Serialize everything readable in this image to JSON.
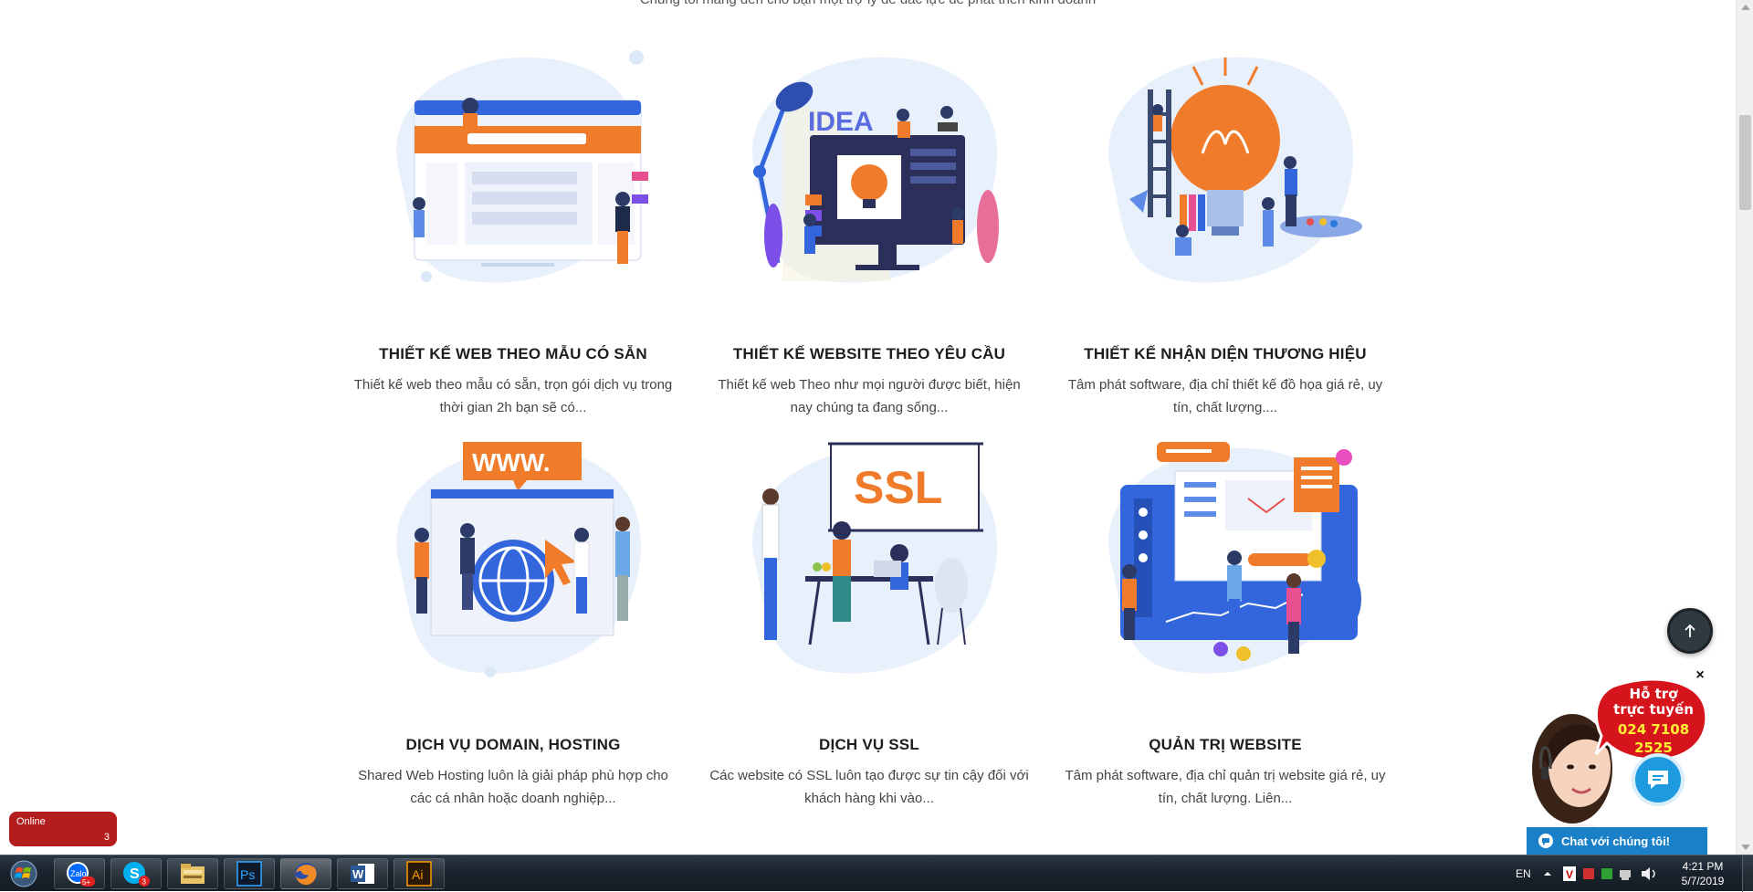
{
  "page": {
    "top_cut_text": "Chúng tôi mang đến cho bạn một trợ lý để đắc lực để phát triển kinh doanh"
  },
  "services": [
    {
      "title": "THIẾT KẾ WEB THEO MẪU CÓ SẴN",
      "desc": "Thiết kế web theo mẫu có sẵn, trọn gói dịch vụ trong thời gian 2h bạn sẽ có..."
    },
    {
      "title": "THIẾT KẾ WEBSITE THEO YÊU CẦU",
      "desc": "Thiết kế web Theo như mọi người được biết, hiện nay chúng ta đang sống..."
    },
    {
      "title": "THIẾT KẾ NHẬN DIỆN THƯƠNG HIỆU",
      "desc": "Tâm phát software, địa chỉ thiết kế đồ họa giá rẻ, uy tín, chất lượng...."
    },
    {
      "title": "DỊCH VỤ DOMAIN, HOSTING",
      "desc": "Shared Web Hosting luôn là giải pháp phù hợp cho các cá nhân hoặc doanh nghiệp..."
    },
    {
      "title": "DỊCH VỤ SSL",
      "desc": "Các website có SSL luôn tạo được sự tin cậy đối với khách hàng khi vào..."
    },
    {
      "title": "QUẢN TRỊ WEBSITE",
      "desc": "Tâm phát software, địa chỉ quản trị website giá rẻ, uy tín, chất lượng. Liên..."
    }
  ],
  "illustrations": {
    "idea_text": "IDEA",
    "www_text": "WWW.",
    "ssl_text": "SSL"
  },
  "online_badge": {
    "label": "Online",
    "count": "3"
  },
  "support": {
    "line1": "Hỗ trợ",
    "line2": "trực tuyến",
    "phone": "024 7108 2525",
    "chat_label": "Chat với chúng tôi!",
    "close": "×"
  },
  "taskbar": {
    "apps": [
      {
        "name": "Zalo",
        "label": "Zalo",
        "badge": "5+"
      },
      {
        "name": "Skype",
        "label": "S",
        "badge": "3"
      },
      {
        "name": "Explorer",
        "label": ""
      },
      {
        "name": "Photoshop",
        "label": "Ps"
      },
      {
        "name": "Firefox",
        "label": ""
      },
      {
        "name": "Word",
        "label": "W"
      },
      {
        "name": "Illustrator",
        "label": "Ai"
      }
    ],
    "language": "EN",
    "time": "4:21 PM",
    "date": "5/7/2019"
  },
  "colors": {
    "accent_orange": "#f07b2b",
    "accent_blue": "#2f66e0",
    "badge_red": "#b41d1d",
    "chat_blue": "#1a80c8",
    "title_color": "#1d1d1d"
  }
}
